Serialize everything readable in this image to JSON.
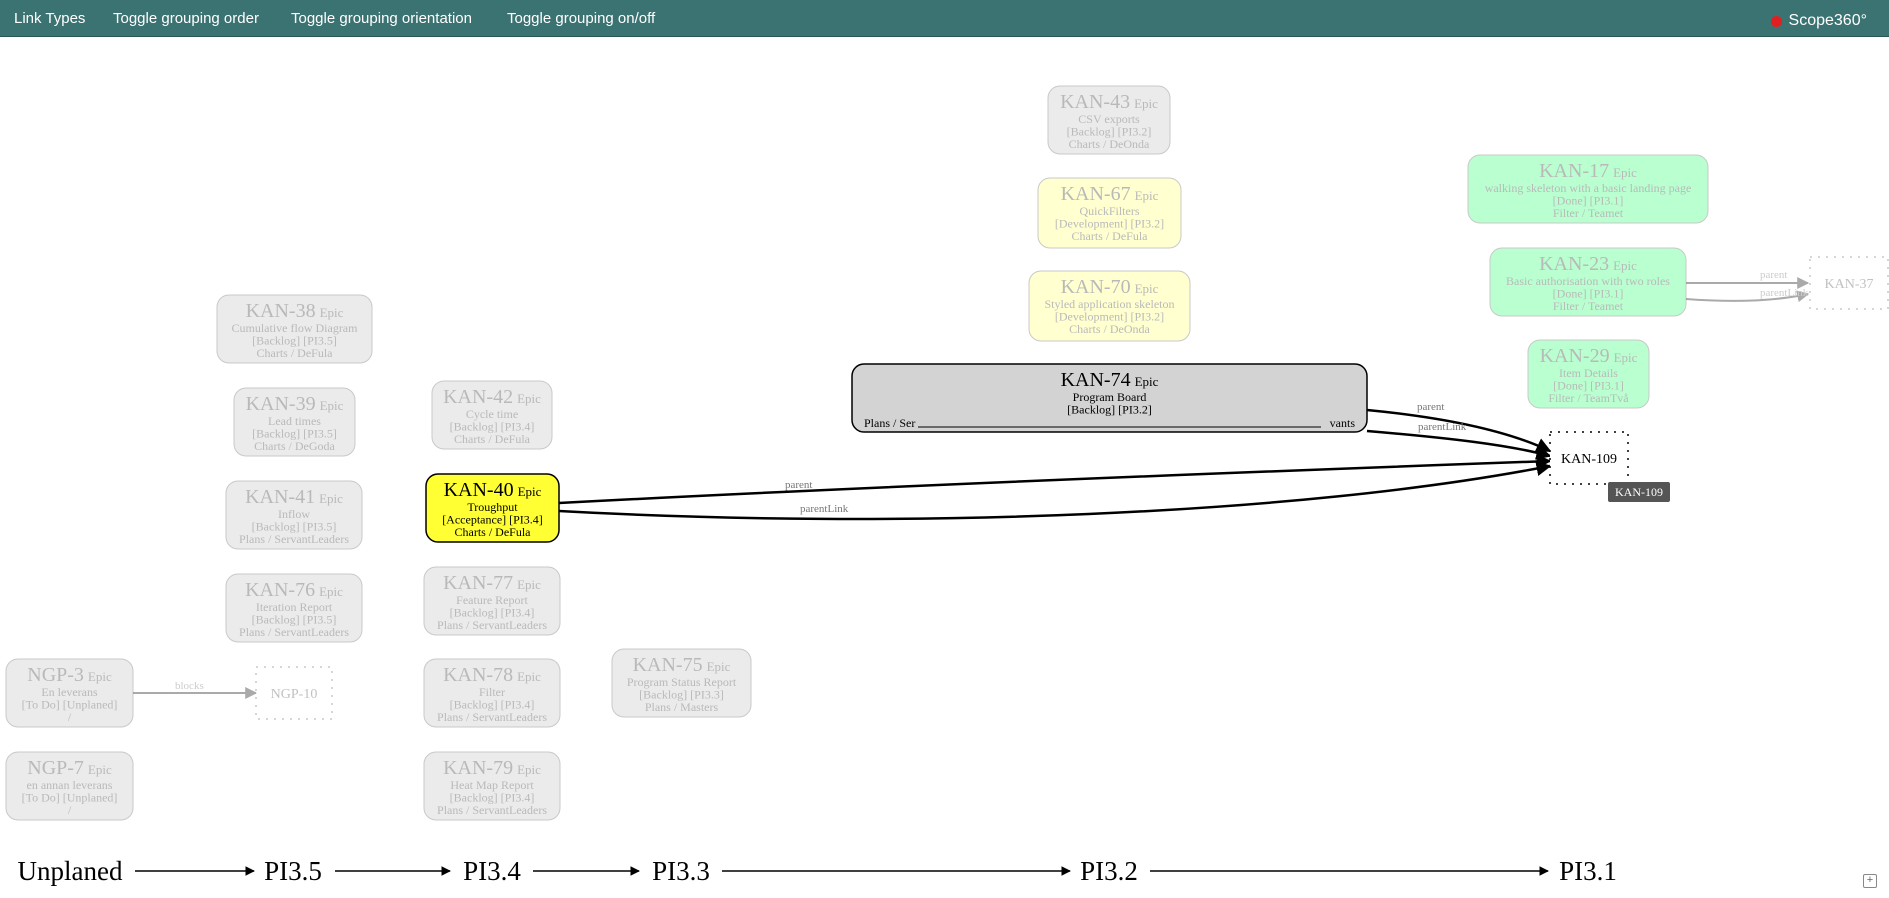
{
  "menu": {
    "link_types": "Link Types",
    "toggle_order": "Toggle grouping order",
    "toggle_orientation": "Toggle grouping orientation",
    "toggle_onoff": "Toggle grouping on/off"
  },
  "brand": {
    "name": "Scope360°"
  },
  "colors": {
    "topbar": "#3b7272",
    "backlog_fill": "#d3d3d3",
    "development_fill": "#ffff99",
    "done_fill": "#66ff99",
    "acceptance_fill": "#ffff33",
    "selected_border": "#000000"
  },
  "columns": [
    "Unplaned",
    "PI3.5",
    "PI3.4",
    "PI3.3",
    "PI3.2",
    "PI3.1"
  ],
  "nodes": [
    {
      "id": "KAN-43",
      "type": "Epic",
      "lines": [
        "CSV exports",
        "[Backlog] [PI3.2]",
        "Charts / DeOnda"
      ],
      "status": "backlog",
      "faded": true
    },
    {
      "id": "KAN-67",
      "type": "Epic",
      "lines": [
        "QuickFilters",
        "[Development] [PI3.2]",
        "Charts / DeFula"
      ],
      "status": "development",
      "faded": true
    },
    {
      "id": "KAN-70",
      "type": "Epic",
      "lines": [
        "Styled application skeleton",
        "[Development] [PI3.2]",
        "Charts / DeOnda"
      ],
      "status": "development",
      "faded": true
    },
    {
      "id": "KAN-74",
      "type": "Epic",
      "lines": [
        "Program Board",
        "[Backlog] [PI3.2]"
      ],
      "footer_left": "Plans / Ser",
      "footer_right": "vants",
      "status": "backlog",
      "faded": false
    },
    {
      "id": "KAN-17",
      "type": "Epic",
      "lines": [
        "walking skeleton with a basic landing page",
        "[Done] [PI3.1]",
        "Filter / Teamet"
      ],
      "status": "done",
      "faded": true
    },
    {
      "id": "KAN-23",
      "type": "Epic",
      "lines": [
        "Basic authorisation with two roles",
        "[Done] [PI3.1]",
        "Filter / Teamet"
      ],
      "status": "done",
      "faded": true
    },
    {
      "id": "KAN-29",
      "type": "Epic",
      "lines": [
        "Item Details",
        "[Done] [PI3.1]",
        "Filter / TeamTvå"
      ],
      "status": "done",
      "faded": true
    },
    {
      "id": "KAN-38",
      "type": "Epic",
      "lines": [
        "Cumulative flow Diagram",
        "[Backlog] [PI3.5]",
        "Charts / DeFula"
      ],
      "status": "backlog",
      "faded": true
    },
    {
      "id": "KAN-39",
      "type": "Epic",
      "lines": [
        "Lead times",
        "[Backlog] [PI3.5]",
        "Charts / DeGoda"
      ],
      "status": "backlog",
      "faded": true
    },
    {
      "id": "KAN-41",
      "type": "Epic",
      "lines": [
        "Inflow",
        "[Backlog] [PI3.5]",
        "Plans / ServantLeaders"
      ],
      "status": "backlog",
      "faded": true
    },
    {
      "id": "KAN-76",
      "type": "Epic",
      "lines": [
        "Iteration Report",
        "[Backlog] [PI3.5]",
        "Plans / ServantLeaders"
      ],
      "status": "backlog",
      "faded": true
    },
    {
      "id": "KAN-42",
      "type": "Epic",
      "lines": [
        "Cycle time",
        "[Backlog] [PI3.4]",
        "Charts / DeFula"
      ],
      "status": "backlog",
      "faded": true
    },
    {
      "id": "KAN-40",
      "type": "Epic",
      "lines": [
        "Troughput",
        "[Acceptance] [PI3.4]",
        "Charts / DeFula"
      ],
      "status": "acceptance",
      "faded": false
    },
    {
      "id": "KAN-77",
      "type": "Epic",
      "lines": [
        "Feature Report",
        "[Backlog] [PI3.4]",
        "Plans / ServantLeaders"
      ],
      "status": "backlog",
      "faded": true
    },
    {
      "id": "KAN-78",
      "type": "Epic",
      "lines": [
        "Filter",
        "[Backlog] [PI3.4]",
        "Plans / ServantLeaders"
      ],
      "status": "backlog",
      "faded": true
    },
    {
      "id": "KAN-79",
      "type": "Epic",
      "lines": [
        "Heat Map Report",
        "[Backlog] [PI3.4]",
        "Plans / ServantLeaders"
      ],
      "status": "backlog",
      "faded": true
    },
    {
      "id": "KAN-75",
      "type": "Epic",
      "lines": [
        "Program Status Report",
        "[Backlog] [PI3.3]",
        "Plans / Masters"
      ],
      "status": "backlog",
      "faded": true
    },
    {
      "id": "NGP-3",
      "type": "Epic",
      "lines": [
        "En leverans",
        "[To Do] [Unplaned]",
        "/"
      ],
      "status": "backlog",
      "faded": true
    },
    {
      "id": "NGP-7",
      "type": "Epic",
      "lines": [
        "en annan leverans",
        "[To Do] [Unplaned]",
        "/"
      ],
      "status": "backlog",
      "faded": true
    }
  ],
  "placeholders": [
    {
      "id": "KAN-109",
      "faded": false
    },
    {
      "id": "KAN-37",
      "faded": true
    },
    {
      "id": "NGP-10",
      "faded": true
    }
  ],
  "edges": [
    {
      "from": "KAN-40",
      "to": "KAN-109",
      "label": "parent",
      "faded": false
    },
    {
      "from": "KAN-40",
      "to": "KAN-109",
      "label": "parentLink",
      "faded": false
    },
    {
      "from": "KAN-74",
      "to": "KAN-109",
      "label": "parent",
      "faded": false
    },
    {
      "from": "KAN-74",
      "to": "KAN-109",
      "label": "parentLink",
      "faded": false
    },
    {
      "from": "KAN-23",
      "to": "KAN-37",
      "label": "parent",
      "faded": true
    },
    {
      "from": "KAN-23",
      "to": "KAN-37",
      "label": "parentLink",
      "faded": true
    },
    {
      "from": "NGP-3",
      "to": "NGP-10",
      "label": "blocks",
      "faded": true
    }
  ],
  "tooltip": {
    "text": "KAN-109"
  }
}
